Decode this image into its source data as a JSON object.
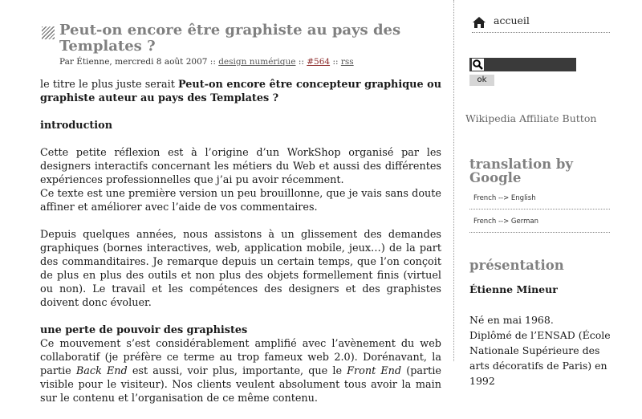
{
  "post": {
    "title": "Peut-on encore être graphiste au pays des Templates ?",
    "meta_prefix": "Par Étienne, mercredi 8 août 2007 ::",
    "category": "design numérique",
    "sep1": "::",
    "number": "#564",
    "sep2": "::",
    "rss": "rss"
  },
  "content": {
    "lead_text": "le titre le plus juste serait ",
    "lead_bold": "Peut-on encore être concepteur graphique ou graphiste auteur au pays des Templates ?",
    "h_intro": "introduction",
    "p1a": "Cette petite réflexion est à l’origine d’un WorkShop organisé par les designers interactifs concernant les métiers du Web et aussi des différentes expériences professionnelles que j’ai pu avoir récemment.",
    "p1b": "Ce texte est une première version un peu brouillonne, que je vais sans doute affiner et améliorer avec l’aide de vos commentaires.",
    "p2": "Depuis quelques années, nous assistons à un glissement des demandes graphiques (bornes interactives, web, application mobile, jeux…) de la part des commanditaires. Je remarque depuis un certain temps, que l’on conçoit de plus en plus des outils et non plus des objets formellement finis (virtuel ou non). Le travail et les compétences des designers et des graphistes doivent donc évoluer.",
    "h_perte": "une perte de pouvoir des graphistes",
    "p3_1": "Ce mouvement s’est considérablement amplifié avec l’avènement du web collaboratif (je préfère ce terme au trop fameux web 2.0). Dorénavant, la partie ",
    "p3_em1": "Back End",
    "p3_2": " est aussi, voir plus, importante, que le ",
    "p3_em2": "Front End",
    "p3_3": " (partie visible pour le visiteur). Nos clients veulent absolument tous avoir la main sur le contenu et l’organisation de ce même contenu."
  },
  "sidebar": {
    "home_label": "accueil",
    "search_value": "",
    "ok_label": "ok",
    "affiliate": "Wikipedia Affiliate Button",
    "translation_title": "translation by Google",
    "trans_fr_en": "French --> English",
    "trans_fr_de": "French --> German",
    "presentation_title": "présentation",
    "author_name": "Étienne Mineur",
    "bio_1": "Né en mai 1968.",
    "bio_2": "Diplômé de l’ENSAD (École Nationale Supérieure des arts décoratifs de Paris) en 1992"
  },
  "colors": {
    "heading_gray": "#808080",
    "link_number": "#8b2a2a",
    "search_bg": "#3a3a3a"
  }
}
